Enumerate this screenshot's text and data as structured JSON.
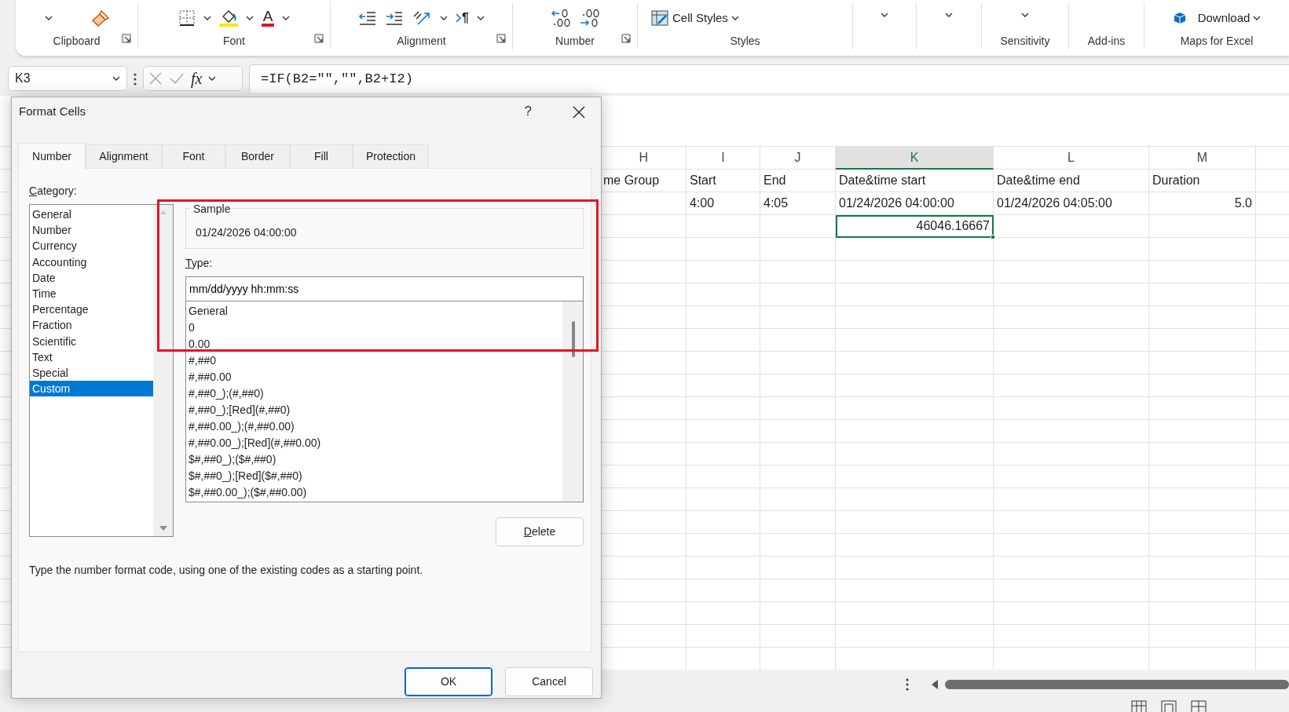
{
  "ribbon": {
    "groups": [
      {
        "label": "Clipboard",
        "launcher": true,
        "controls": [
          {
            "kind": "chevron"
          },
          {
            "kind": "brush"
          }
        ]
      },
      {
        "label": "Font",
        "launcher": true,
        "controls": [
          {
            "kind": "borders"
          },
          {
            "kind": "fill"
          },
          {
            "kind": "font-color",
            "glyph": "A"
          }
        ]
      },
      {
        "label": "Alignment",
        "launcher": true,
        "controls": [
          {
            "kind": "outdent"
          },
          {
            "kind": "indent"
          },
          {
            "kind": "orientation"
          },
          {
            "kind": "paragraph",
            "glyph": "¶"
          }
        ]
      },
      {
        "label": "Number",
        "launcher": true,
        "controls": [
          {
            "kind": "increase-decimal"
          },
          {
            "kind": "decrease-decimal"
          }
        ]
      },
      {
        "label": "Styles",
        "launcher": false,
        "controls": [
          {
            "kind": "cell-styles",
            "label": "Cell Styles"
          }
        ]
      },
      {
        "launcher": false,
        "controls": [
          {
            "kind": "chevron"
          }
        ]
      },
      {
        "launcher": false,
        "controls": [
          {
            "kind": "chevron"
          }
        ]
      },
      {
        "label": "Sensitivity",
        "launcher": false,
        "controls": [
          {
            "kind": "chevron"
          }
        ]
      },
      {
        "label": "Add-ins",
        "launcher": false
      },
      {
        "label": "Maps for Excel",
        "launcher": false,
        "controls": [
          {
            "kind": "download",
            "label": "Download"
          }
        ]
      }
    ]
  },
  "formula_bar": {
    "name_box": "K3",
    "fx_glyph": "fx",
    "formula": "=IF(B2=\"\",\"\",B2+I2)"
  },
  "sheet": {
    "columns": [
      {
        "letter": "H",
        "selected": false
      },
      {
        "letter": "I",
        "selected": false
      },
      {
        "letter": "J",
        "selected": false
      },
      {
        "letter": "K",
        "selected": true
      },
      {
        "letter": "L",
        "selected": false
      },
      {
        "letter": "M",
        "selected": false
      }
    ],
    "rows": [
      {
        "cells": [
          {
            "text": "me Group",
            "kind": "text",
            "selected": false
          },
          {
            "text": "Start",
            "kind": "text",
            "selected": false
          },
          {
            "text": "End",
            "kind": "text",
            "selected": false
          },
          {
            "text": "Date&time start",
            "kind": "text",
            "selected": false
          },
          {
            "text": "Date&time end",
            "kind": "text",
            "selected": false
          },
          {
            "text": "Duration",
            "kind": "text",
            "selected": false
          }
        ]
      },
      {
        "cells": [
          {
            "selected": false
          },
          {
            "text": "4:00",
            "kind": "text",
            "selected": false
          },
          {
            "text": "4:05",
            "kind": "text",
            "selected": false
          },
          {
            "text": "01/24/2026 04:00:00",
            "kind": "text",
            "selected": false
          },
          {
            "text": "01/24/2026 04:05:00",
            "kind": "text",
            "selected": false
          },
          {
            "text": "5.0",
            "kind": "number",
            "selected": false
          }
        ]
      },
      {
        "cells": [
          {
            "selected": false
          },
          {
            "selected": false
          },
          {
            "selected": false
          },
          {
            "text": "46046.16667",
            "kind": "number",
            "selected": true
          },
          {
            "selected": false
          },
          {
            "selected": false
          }
        ]
      }
    ]
  },
  "dialog": {
    "title": "Format Cells",
    "help_glyph": "?",
    "tabs": [
      {
        "label": "Number",
        "selected": true
      },
      {
        "label": "Alignment",
        "selected": false
      },
      {
        "label": "Font",
        "selected": false
      },
      {
        "label": "Border",
        "selected": false
      },
      {
        "label": "Fill",
        "selected": false
      },
      {
        "label": "Protection",
        "selected": false
      }
    ],
    "category_label": {
      "text": "Category:",
      "access_key": true
    },
    "categories": [
      {
        "label": "General",
        "selected": false
      },
      {
        "label": "Number",
        "selected": false
      },
      {
        "label": "Currency",
        "selected": false
      },
      {
        "label": "Accounting",
        "selected": false
      },
      {
        "label": "Date",
        "selected": false
      },
      {
        "label": "Time",
        "selected": false
      },
      {
        "label": "Percentage",
        "selected": false
      },
      {
        "label": "Fraction",
        "selected": false
      },
      {
        "label": "Scientific",
        "selected": false
      },
      {
        "label": "Text",
        "selected": false
      },
      {
        "label": "Special",
        "selected": false
      },
      {
        "label": "Custom",
        "selected": true
      }
    ],
    "sample": {
      "legend": "Sample",
      "value": "01/24/2026 04:00:00"
    },
    "type_label": {
      "text": "Type:",
      "access_key": true
    },
    "type_value": "mm/dd/yyyy hh:mm:ss",
    "type_list": [
      "General",
      "0",
      "0.00",
      "#,##0",
      "#,##0.00",
      "#,##0_);(#,##0)",
      "#,##0_);[Red](#,##0)",
      "#,##0.00_);(#,##0.00)",
      "#,##0.00_);[Red](#,##0.00)",
      "$#,##0_);($#,##0)",
      "$#,##0_);[Red]($#,##0)",
      "$#,##0.00_);($#,##0.00)"
    ],
    "delete_button": {
      "text": "Delete",
      "access_key": true
    },
    "description": "Type the number format code, using one of the existing codes as a starting point.",
    "buttons": [
      {
        "label": "OK",
        "default": true
      },
      {
        "label": "Cancel",
        "default": false
      }
    ],
    "highlight_frame": true
  }
}
